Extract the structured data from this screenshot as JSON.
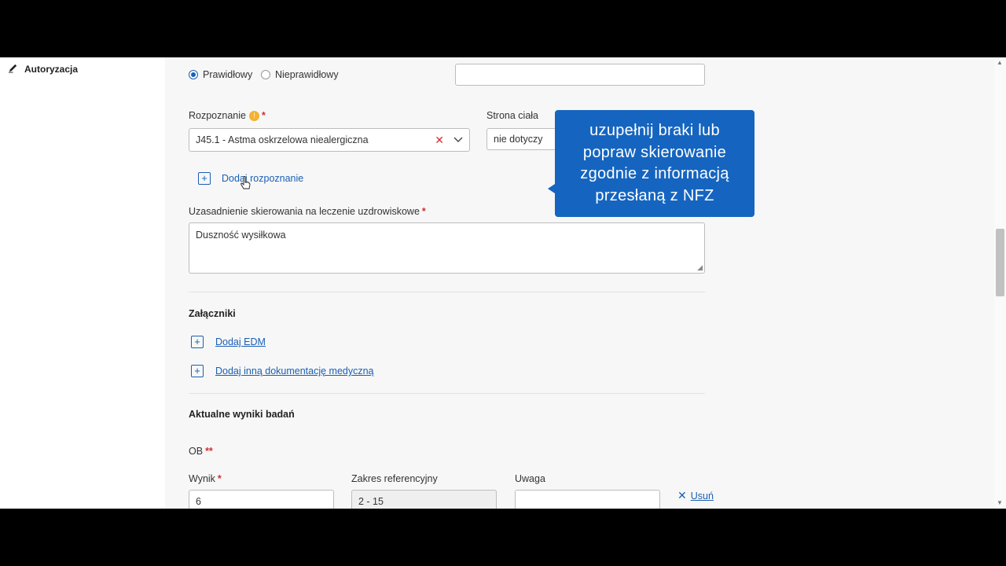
{
  "sidebar": {
    "authorization_label": "Autoryzacja"
  },
  "form": {
    "radio_valid": "Prawidłowy",
    "radio_invalid": "Nieprawidłowy",
    "diagnosis_label": "Rozpoznanie",
    "required_mark": "*",
    "double_required_mark": "**",
    "diagnosis_value": "J45.1 - Astma oskrzelowa niealergiczna",
    "body_side_label": "Strona ciała",
    "body_side_value": "nie dotyczy",
    "add_diagnosis": "Dodaj rozpoznanie",
    "justification_label": "Uzasadnienie skierowania na leczenie uzdrowiskowe",
    "justification_value": "Duszność wysiłkowa",
    "attachments_title": "Załączniki",
    "add_edm": "Dodaj EDM",
    "add_other_docs": "Dodaj inną dokumentację medyczną",
    "results_title": "Aktualne wyniki badań",
    "ob_label": "OB",
    "result_label": "Wynik",
    "result_value": "6",
    "ref_range_label": "Zakres referencyjny",
    "ref_range_value": "2 - 15",
    "note_label": "Uwaga",
    "note_value": "",
    "remove_label": "Usuń"
  },
  "tooltip": {
    "lines": [
      "uzupełnij braki lub",
      "popraw skierowanie",
      "zgodnie z informacją",
      "przesłaną z NFZ"
    ]
  },
  "colors": {
    "accent": "#1a5fb4",
    "tooltip_bg": "#1565c0",
    "required": "#d32f2f",
    "warning": "#f2b233"
  }
}
